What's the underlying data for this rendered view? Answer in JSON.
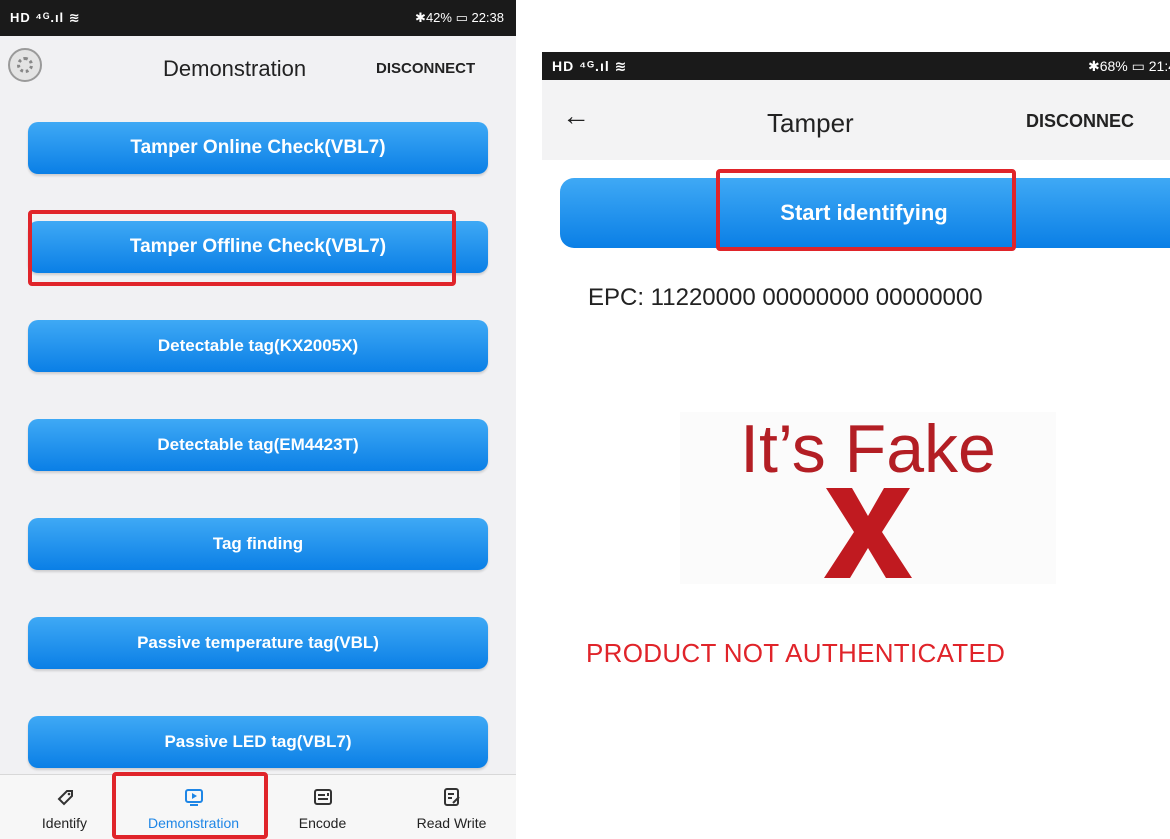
{
  "left_screen": {
    "status": {
      "left": "HD ⁴ᴳ.ıl ≋",
      "right": "✱42% ▭ 22:38"
    },
    "header": {
      "title": "Demonstration",
      "disconnect": "DISCONNECT",
      "logo_icon": "wheel-logo-icon"
    },
    "menu": [
      "Tamper Online Check(VBL7)",
      "Tamper Offline Check(VBL7)",
      "Detectable tag(KX2005X)",
      "Detectable tag(EM4423T)",
      "Tag finding",
      "Passive temperature tag(VBL)",
      "Passive LED tag(VBL7)"
    ],
    "nav": [
      {
        "label": "Identify",
        "icon": "tag-icon"
      },
      {
        "label": "Demonstration",
        "icon": "play-screen-icon",
        "active": true
      },
      {
        "label": "Encode",
        "icon": "encode-card-icon"
      },
      {
        "label": "Read Write",
        "icon": "edit-note-icon"
      }
    ]
  },
  "right_screen": {
    "status": {
      "left": "HD ⁴ᴳ.ıl ≋",
      "right": "✱68% ▭ 21:4"
    },
    "header": {
      "back_icon": "arrow-left-icon",
      "title": "Tamper",
      "disconnect": "DISCONNEC"
    },
    "start_button": "Start identifying",
    "epc": "EPC: 11220000 00000000 00000000",
    "result_text": "It’s Fake",
    "result_icon": "red-x-icon",
    "not_authenticated": "PRODUCT NOT AUTHENTICATED"
  },
  "colors": {
    "accent_blue": "#1e86e6",
    "highlight_red": "#e0242a",
    "fake_red": "#b31e24"
  }
}
